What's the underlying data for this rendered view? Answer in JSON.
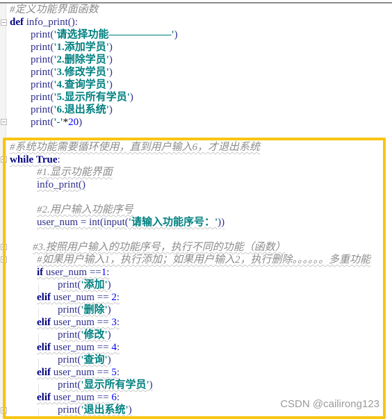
{
  "editor": {
    "language": "python",
    "lines": [
      {
        "indent": 0,
        "tokens": [
          {
            "t": "cm",
            "v": "#定义功能界面函数"
          }
        ]
      },
      {
        "indent": 0,
        "tokens": [
          {
            "t": "kw",
            "v": "def"
          },
          {
            "t": "plain",
            "v": " info_print():"
          }
        ]
      },
      {
        "indent": 1,
        "tokens": [
          {
            "t": "fn",
            "v": "print("
          },
          {
            "t": "str",
            "v": "'请选择功能——————'"
          },
          {
            "t": "fn",
            "v": ")"
          }
        ]
      },
      {
        "indent": 1,
        "tokens": [
          {
            "t": "fn",
            "v": "print("
          },
          {
            "t": "str",
            "v": "'1.添加学员'"
          },
          {
            "t": "fn",
            "v": ")"
          }
        ]
      },
      {
        "indent": 1,
        "tokens": [
          {
            "t": "fn",
            "v": "print("
          },
          {
            "t": "str",
            "v": "'2.删除学员'"
          },
          {
            "t": "fn",
            "v": ")"
          }
        ]
      },
      {
        "indent": 1,
        "tokens": [
          {
            "t": "fn",
            "v": "print("
          },
          {
            "t": "str",
            "v": "'3.修改学员'"
          },
          {
            "t": "fn",
            "v": ")"
          }
        ]
      },
      {
        "indent": 1,
        "tokens": [
          {
            "t": "fn",
            "v": "print("
          },
          {
            "t": "str",
            "v": "'4.查询学员'"
          },
          {
            "t": "fn",
            "v": ")"
          }
        ]
      },
      {
        "indent": 1,
        "tokens": [
          {
            "t": "fn",
            "v": "print("
          },
          {
            "t": "str",
            "v": "'5.显示所有学员'"
          },
          {
            "t": "fn",
            "v": ")"
          }
        ]
      },
      {
        "indent": 1,
        "tokens": [
          {
            "t": "fn",
            "v": "print("
          },
          {
            "t": "str",
            "v": "'6.退出系统'"
          },
          {
            "t": "fn",
            "v": ")"
          }
        ]
      },
      {
        "indent": 1,
        "tokens": [
          {
            "t": "fn",
            "v": "print("
          },
          {
            "t": "str",
            "v": "'-'"
          },
          {
            "t": "op",
            "v": "*"
          },
          {
            "t": "num",
            "v": "20"
          },
          {
            "t": "fn",
            "v": ")"
          }
        ]
      },
      {
        "indent": 0,
        "tokens": []
      },
      {
        "indent": 0,
        "tokens": [
          {
            "t": "cm",
            "v": "#系统功能需要循环使用，直到用户输入6，才退出系统"
          }
        ]
      },
      {
        "indent": 0,
        "tokens": [
          {
            "t": "kw",
            "v": "while"
          },
          {
            "t": "plain",
            "v": " "
          },
          {
            "t": "kw",
            "v": "True"
          },
          {
            "t": "plain",
            "v": ":"
          }
        ]
      },
      {
        "indent": 1.3,
        "tokens": [
          {
            "t": "cm",
            "v": "#1.显示功能界面"
          }
        ]
      },
      {
        "indent": 1.3,
        "tokens": [
          {
            "t": "plain",
            "v": "info_print()"
          }
        ]
      },
      {
        "indent": 0,
        "tokens": []
      },
      {
        "indent": 1.3,
        "tokens": [
          {
            "t": "cm",
            "v": "#2.用户输入功能序号"
          }
        ]
      },
      {
        "indent": 1.3,
        "tokens": [
          {
            "t": "plain",
            "v": "user_num = int(input("
          },
          {
            "t": "str",
            "v": "'请输入功能序号：'"
          },
          {
            "t": "plain",
            "v": "))"
          }
        ]
      },
      {
        "indent": 0,
        "tokens": []
      },
      {
        "indent": 1.1,
        "tokens": [
          {
            "t": "cm",
            "v": "#3.按照用户输入的功能序号，执行不同的功能（函数）"
          }
        ]
      },
      {
        "indent": 1.3,
        "tokens": [
          {
            "t": "cm",
            "v": "#如果用户输入1，执行添加；如果用户输入2，执行删除。。。。。。多重功能"
          }
        ]
      },
      {
        "indent": 1.3,
        "tokens": [
          {
            "t": "kw",
            "v": "if"
          },
          {
            "t": "plain",
            "v": " user_num =="
          },
          {
            "t": "num",
            "v": "1"
          },
          {
            "t": "plain",
            "v": ":"
          }
        ]
      },
      {
        "indent": 2.3,
        "tokens": [
          {
            "t": "fn",
            "v": "print("
          },
          {
            "t": "str",
            "v": "'添加'"
          },
          {
            "t": "fn",
            "v": ")"
          }
        ]
      },
      {
        "indent": 1.3,
        "tokens": [
          {
            "t": "kw",
            "v": "elif"
          },
          {
            "t": "plain",
            "v": " user_num == "
          },
          {
            "t": "num",
            "v": "2"
          },
          {
            "t": "plain",
            "v": ":"
          }
        ]
      },
      {
        "indent": 2.3,
        "tokens": [
          {
            "t": "fn",
            "v": "print("
          },
          {
            "t": "str",
            "v": "'删除'"
          },
          {
            "t": "fn",
            "v": ")"
          }
        ]
      },
      {
        "indent": 1.3,
        "tokens": [
          {
            "t": "kw",
            "v": "elif"
          },
          {
            "t": "plain",
            "v": " user_num == "
          },
          {
            "t": "num",
            "v": "3"
          },
          {
            "t": "plain",
            "v": ":"
          }
        ]
      },
      {
        "indent": 2.3,
        "tokens": [
          {
            "t": "fn",
            "v": "print("
          },
          {
            "t": "str",
            "v": "'修改'"
          },
          {
            "t": "fn",
            "v": ")"
          }
        ]
      },
      {
        "indent": 1.3,
        "tokens": [
          {
            "t": "kw",
            "v": "elif"
          },
          {
            "t": "plain",
            "v": " user_num == "
          },
          {
            "t": "num",
            "v": "4"
          },
          {
            "t": "plain",
            "v": ":"
          }
        ]
      },
      {
        "indent": 2.3,
        "tokens": [
          {
            "t": "fn",
            "v": "print("
          },
          {
            "t": "str",
            "v": "'查询'"
          },
          {
            "t": "fn",
            "v": ")"
          }
        ]
      },
      {
        "indent": 1.3,
        "tokens": [
          {
            "t": "kw",
            "v": "elif"
          },
          {
            "t": "plain",
            "v": " user_num == "
          },
          {
            "t": "num",
            "v": "5"
          },
          {
            "t": "plain",
            "v": ":"
          }
        ]
      },
      {
        "indent": 2.3,
        "tokens": [
          {
            "t": "fn",
            "v": "print("
          },
          {
            "t": "str",
            "v": "'显示所有学员'"
          },
          {
            "t": "fn",
            "v": ")"
          }
        ]
      },
      {
        "indent": 1.3,
        "tokens": [
          {
            "t": "kw",
            "v": "elif"
          },
          {
            "t": "plain",
            "v": " user_num == "
          },
          {
            "t": "num",
            "v": "6"
          },
          {
            "t": "plain",
            "v": ":"
          }
        ]
      },
      {
        "indent": 2.3,
        "tokens": [
          {
            "t": "fn",
            "v": "print("
          },
          {
            "t": "str",
            "v": "'退出系统'"
          },
          {
            "t": "fn",
            "v": ")"
          }
        ]
      }
    ]
  },
  "colors": {
    "highlight": "#f7c514",
    "keyword": "#000080",
    "string": "#008080",
    "number": "#0000ff",
    "comment": "#8c8c8c"
  },
  "watermark": "CSDN @cailirong123"
}
